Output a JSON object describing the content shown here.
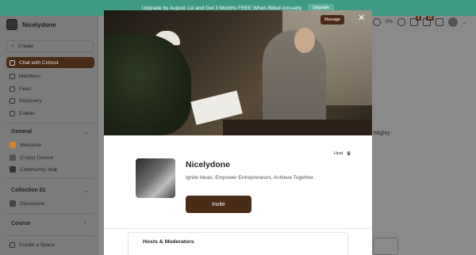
{
  "banner": {
    "text": "Upgrade by August 1st and Get 3 Months FREE When Billed Annually",
    "button": "Upgrade"
  },
  "brand": {
    "name": "Nicelydone"
  },
  "sidebar": {
    "create_label": "Create",
    "nav": [
      {
        "label": "Chat with Cohost",
        "icon": "chat-icon",
        "active": true
      },
      {
        "label": "Members",
        "icon": "members-icon"
      },
      {
        "label": "Feed",
        "icon": "feed-icon"
      },
      {
        "label": "Discovery",
        "icon": "discovery-icon"
      },
      {
        "label": "Events",
        "icon": "events-icon"
      }
    ],
    "sections": [
      {
        "title": "General",
        "items": [
          {
            "label": "Welcome",
            "color": "#d9822b"
          },
          {
            "label": "(Copy) Course",
            "color": "#555555"
          },
          {
            "label": "Community chat",
            "color": "#333333"
          }
        ]
      },
      {
        "title": "Collection 01",
        "items": [
          {
            "label": "Discussion",
            "color": "#444444"
          }
        ]
      },
      {
        "title": "Course",
        "items": []
      }
    ],
    "create_space": "Create a Space"
  },
  "topbar": {
    "progress": "0%",
    "badge_a": "3",
    "badge_b": "10"
  },
  "background": {
    "side_text": "Mighty"
  },
  "modal": {
    "manage_label": "Manage",
    "host_label": "Host",
    "community_name": "Nicelydone",
    "tagline": "Ignite Ideas, Empower Entrepreneurs, Achieve Together.",
    "invite_label": "Invite",
    "hosts_title": "Hosts & Moderators"
  },
  "colors": {
    "accent": "#4a2b15",
    "banner": "#3e9a82"
  }
}
